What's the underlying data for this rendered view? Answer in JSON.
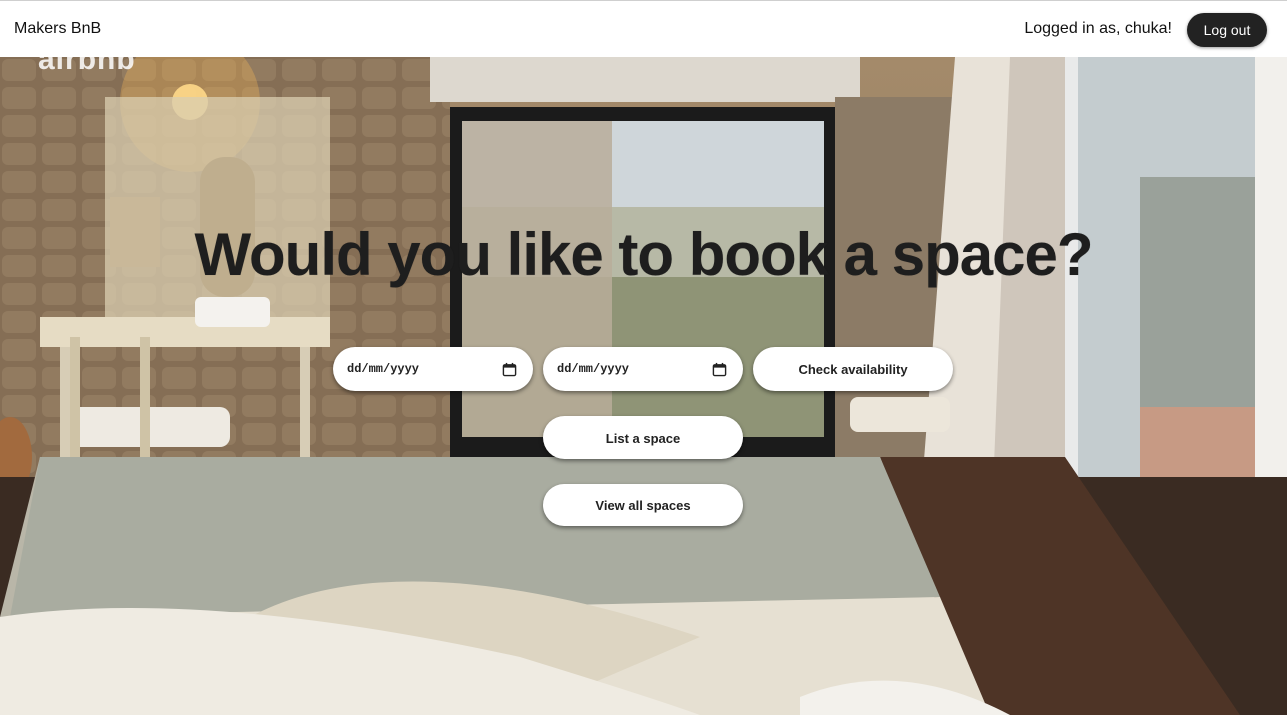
{
  "header": {
    "brand": "Makers BnB",
    "greeting": "Logged in as, chuka!",
    "logout_label": "Log out"
  },
  "hero": {
    "logo_text": "airbnb",
    "headline": "Would you like to book a space?",
    "check_in": {
      "placeholder": "dd/mm/yyyy"
    },
    "check_out": {
      "placeholder": "dd/mm/yyyy"
    },
    "check_availability_label": "Check availability",
    "list_space_label": "List a space",
    "view_all_label": "View all spaces"
  },
  "colors": {
    "logout_bg": "#222222",
    "headline_text": "#1e1e1e",
    "pill_bg": "#ffffff"
  },
  "icons": [
    "calendar-icon"
  ]
}
